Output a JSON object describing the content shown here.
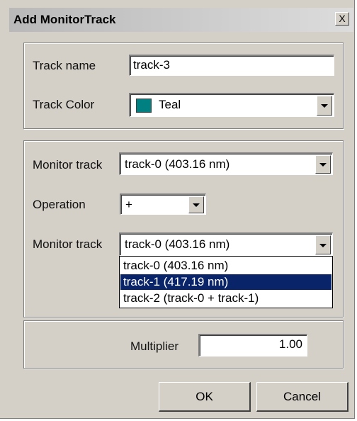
{
  "window": {
    "title": "Add MonitorTrack",
    "close_glyph": "X"
  },
  "track": {
    "name_label": "Track name",
    "name_value": "track-3",
    "color_label": "Track Color",
    "color_value": "Teal",
    "color_swatch": "#008080"
  },
  "operation_group": {
    "monitor_track_1_label": "Monitor track",
    "monitor_track_1_value": "track-0 (403.16 nm)",
    "operation_label": "Operation",
    "operation_value": "+",
    "monitor_track_2_label": "Monitor track",
    "monitor_track_2_value": "track-0 (403.16 nm)",
    "dropdown_options": [
      "track-0 (403.16 nm)",
      "track-1 (417.19 nm)",
      "track-2 (track-0 + track-1)"
    ],
    "highlighted_option": "track-1 (417.19 nm)"
  },
  "multiplier": {
    "label": "Multiplier",
    "value": "1.00"
  },
  "buttons": {
    "ok": "OK",
    "cancel": "Cancel"
  },
  "colors": {
    "dialog_bg": "#d4d0c8",
    "selection_bg": "#0a246a"
  }
}
